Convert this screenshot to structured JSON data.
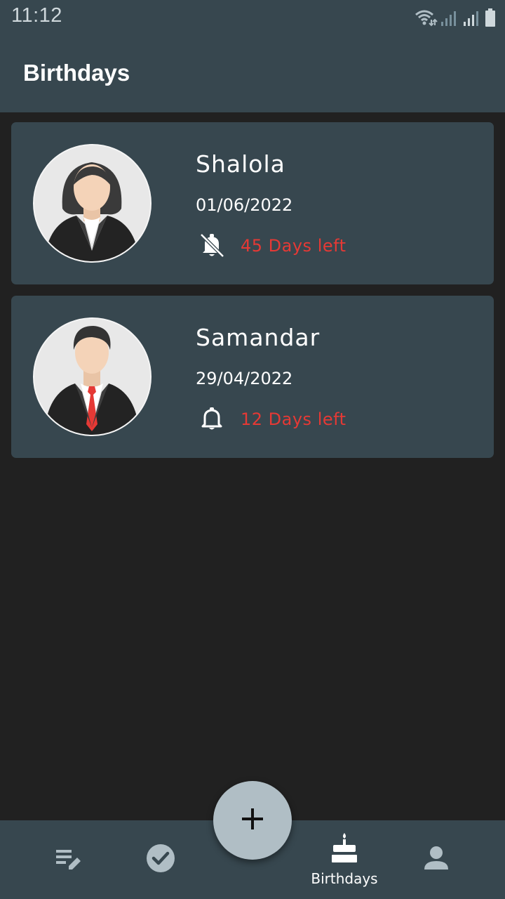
{
  "status_bar": {
    "time": "11:12",
    "icons": [
      "wifi-icon",
      "signal-icon",
      "signal-icon",
      "battery-icon"
    ]
  },
  "app_bar": {
    "title": "Birthdays"
  },
  "birthdays": [
    {
      "name": "Shalola",
      "date": "01/06/2022",
      "days_left": "45 Days left",
      "reminder": "off",
      "avatar": "female-avatar"
    },
    {
      "name": "Samandar",
      "date": "29/04/2022",
      "days_left": "12 Days left",
      "reminder": "on",
      "avatar": "male-avatar"
    }
  ],
  "bottom_nav": {
    "items": [
      {
        "icon": "notes-edit-icon",
        "label": ""
      },
      {
        "icon": "check-circle-icon",
        "label": ""
      },
      {
        "icon": "cake-icon",
        "label": "Birthdays",
        "active": true
      },
      {
        "icon": "person-icon",
        "label": ""
      }
    ]
  },
  "fab": {
    "icon": "plus-icon"
  },
  "colors": {
    "background": "#212121",
    "surface": "#37474f",
    "accent_red": "#e53935",
    "fab": "#b0bec5"
  }
}
